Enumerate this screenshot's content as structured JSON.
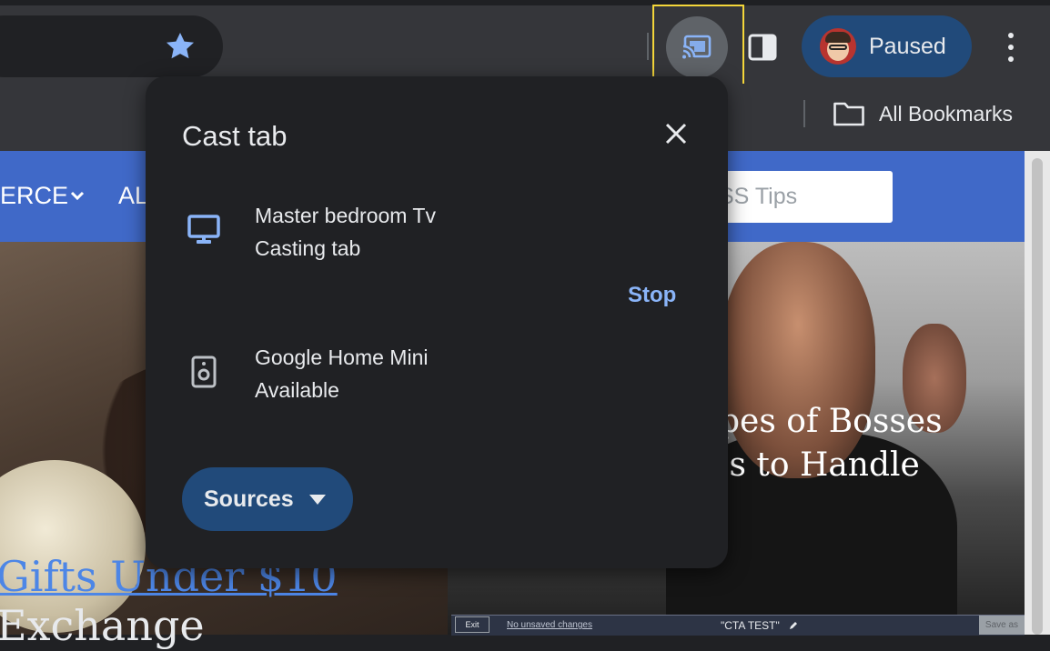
{
  "toolbar": {
    "profile_label": "Paused"
  },
  "bookmarks": {
    "all_bookmarks_label": "All Bookmarks"
  },
  "page": {
    "nav_item_1": "ERCE",
    "nav_item_2": "AL",
    "search_placeholder": "SS Tips",
    "headline_right": "pes of Bosses\n s to Handle",
    "headline_left_1": "Gifts Under $10",
    "headline_left_2": "Exchange",
    "editor": {
      "exit_label": "Exit",
      "unsaved_label": "No unsaved changes",
      "title": "\"CTA TEST\"",
      "save_label": "Save as"
    }
  },
  "cast_dialog": {
    "title": "Cast tab",
    "sinks": [
      {
        "name": "Master bedroom Tv",
        "status": "Casting tab",
        "action": "Stop",
        "icon": "tv-icon"
      },
      {
        "name": "Google Home Mini",
        "status": "Available",
        "icon": "speaker-icon"
      }
    ],
    "sources_label": "Sources"
  },
  "colors": {
    "accent": "#8ab4f8",
    "highlight": "#f4d63a",
    "chip": "#214a7a",
    "site_nav": "#4069c8"
  }
}
